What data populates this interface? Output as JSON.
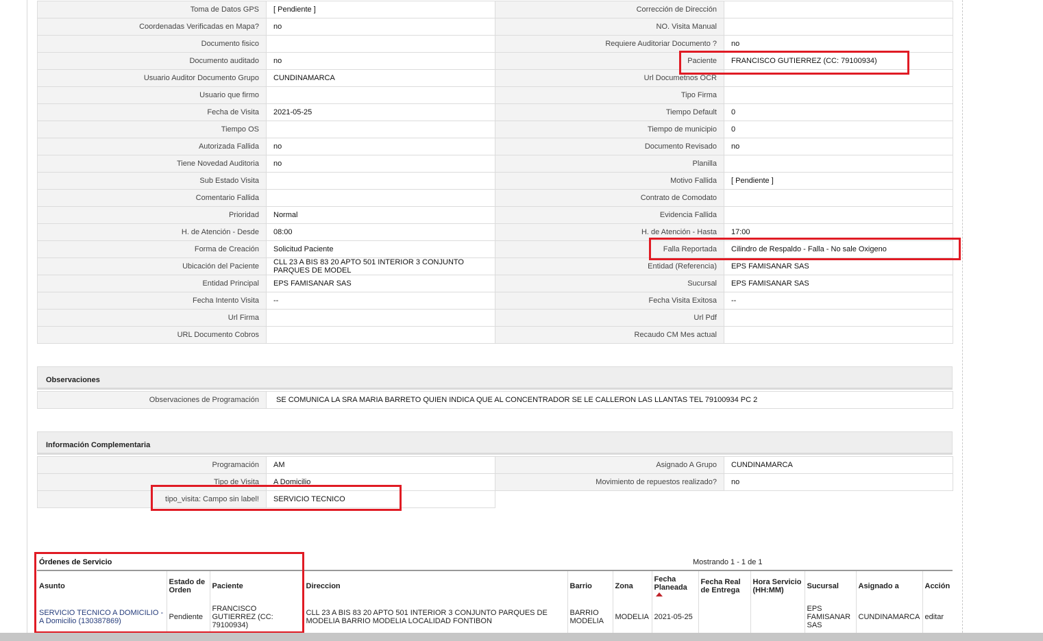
{
  "details": {
    "rows": [
      {
        "l1": "Toma de Datos GPS",
        "v1": "[ Pendiente ]",
        "l2": "Corrección de Dirección",
        "v2": ""
      },
      {
        "l1": "Coordenadas Verificadas en Mapa?",
        "v1": " no",
        "l2": "NO. Visita Manual",
        "v2": ""
      },
      {
        "l1": "Documento fisico",
        "v1": "",
        "l2": "Requiere Auditoriar Documento ?",
        "v2": " no"
      },
      {
        "l1": "Documento auditado",
        "v1": " no",
        "l2": "Paciente",
        "v2": "FRANCISCO GUTIERREZ (CC: 79100934)"
      },
      {
        "l1": "Usuario Auditor Documento Grupo",
        "v1": "CUNDINAMARCA",
        "l2": "Url Documetnos OCR",
        "v2": ""
      },
      {
        "l1": "Usuario que firmo",
        "v1": "",
        "l2": "Tipo Firma",
        "v2": ""
      },
      {
        "l1": "Fecha de Visita",
        "v1": " 2021-05-25",
        "l2": "Tiempo Default",
        "v2": "0"
      },
      {
        "l1": "Tiempo OS",
        "v1": "",
        "l2": "Tiempo de municipio",
        "v2": "0"
      },
      {
        "l1": "Autorizada Fallida",
        "v1": " no",
        "l2": "Documento Revisado",
        "v2": " no"
      },
      {
        "l1": "Tiene Novedad Auditoria",
        "v1": " no",
        "l2": "Planilla",
        "v2": ""
      },
      {
        "l1": "Sub Estado Visita",
        "v1": "",
        "l2": "Motivo Fallida",
        "v2": "[ Pendiente ]"
      },
      {
        "l1": "Comentario Fallida",
        "v1": "",
        "l2": "Contrato de Comodato",
        "v2": ""
      },
      {
        "l1": "Prioridad",
        "v1": "Normal",
        "l2": "Evidencia Fallida",
        "v2": ""
      },
      {
        "l1": "H. de Atención - Desde",
        "v1": "08:00",
        "l2": "H. de Atención - Hasta",
        "v2": "17:00"
      },
      {
        "l1": "Forma de Creación",
        "v1": "Solicitud Paciente",
        "l2": "Falla Reportada",
        "v2": "Cilindro de Respaldo - Falla - No sale Oxigeno"
      },
      {
        "l1": "Ubicación del Paciente",
        "v1": "CLL 23 A BIS 83 20 APTO 501 INTERIOR 3 CONJUNTO PARQUES DE MODEL",
        "l2": "Entidad (Referencia)",
        "v2": "EPS FAMISANAR SAS"
      },
      {
        "l1": "Entidad Principal",
        "v1": "EPS FAMISANAR SAS",
        "l2": "Sucursal",
        "v2": "EPS FAMISANAR SAS"
      },
      {
        "l1": "Fecha Intento Visita",
        "v1": " --",
        "l2": "Fecha Visita Exitosa",
        "v2": " --"
      },
      {
        "l1": "Url Firma",
        "v1": "",
        "l2": "Url Pdf",
        "v2": ""
      },
      {
        "l1": "URL Documento Cobros",
        "v1": "",
        "l2": "Recaudo CM Mes actual",
        "v2": ""
      }
    ]
  },
  "observaciones": {
    "title": "Observaciones",
    "label": "Observaciones de Programación",
    "value": " SE COMUNICA LA SRA MARIA BARRETO QUIEN INDICA QUE AL CONCENTRADOR SE LE CALLERON LAS LLANTAS TEL 79100934 PC 2"
  },
  "complementaria": {
    "title": "Información Complementaria",
    "rows": [
      {
        "l1": "Programación",
        "v1": "AM",
        "l2": "Asignado A Grupo",
        "v2": "CUNDINAMARCA"
      },
      {
        "l1": "Tipo de Visita",
        "v1": "A Domicilio",
        "l2": "Movimiento de repuestos realizado?",
        "v2": " no"
      },
      {
        "l1": "tipo_visita: Campo sin label!",
        "v1": "SERVICIO TECNICO"
      }
    ]
  },
  "orders": {
    "title": "Órdenes de Servicio",
    "count_text": "Mostrando 1 - 1 de 1",
    "headers": {
      "asunto": "Asunto",
      "estado": "Estado de Orden",
      "paciente": "Paciente",
      "direccion": "Direccion",
      "barrio": "Barrio",
      "zona": "Zona",
      "fecha_planeada": "Fecha Planeada",
      "fecha_real": "Fecha Real de Entrega",
      "hora_servicio": "Hora Servicio (HH:MM)",
      "sucursal": "Sucursal",
      "asignado": "Asignado a",
      "accion": "Acción"
    },
    "rows": [
      {
        "asunto": "SERVICIO TECNICO A DOMICILIO - A Domicilio (130387869)",
        "estado": "Pendiente",
        "paciente": "FRANCISCO GUTIERREZ (CC: 79100934)",
        "direccion": "CLL 23 A BIS 83 20 APTO 501 INTERIOR 3 CONJUNTO PARQUES DE MODELIA BARRIO MODELIA LOCALIDAD FONTIBON",
        "barrio": "BARRIO MODELIA",
        "zona": "MODELIA",
        "fecha_planeada": "2021-05-25",
        "fecha_real": "",
        "hora_servicio": "",
        "sucursal": "EPS FAMISANAR SAS",
        "asignado": "CUNDINAMARCA",
        "accion": "editar"
      }
    ]
  },
  "colors": {
    "highlight": "#e01b24",
    "label_bg": "#f3f3f3",
    "section_bg": "#eeeeee",
    "link": "#243b7a"
  }
}
